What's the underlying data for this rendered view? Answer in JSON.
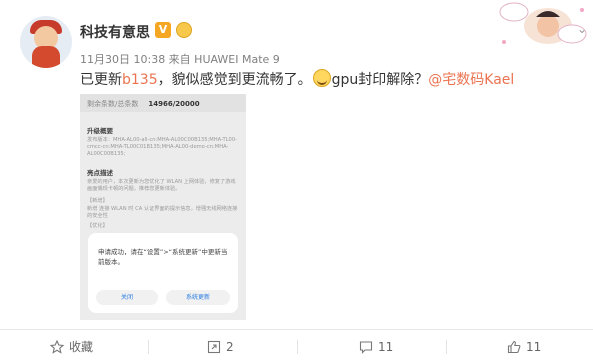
{
  "post": {
    "author": "科技有意思",
    "verified_badge": "V",
    "meta": "11月30日 10:38 来自 HUAWEI Mate 9",
    "text": {
      "part1": "已更新",
      "version": "b135",
      "part2": "，貌似感觉到更流畅了。",
      "part3": "gpu封印解除？",
      "mention": "@宅数码Kael"
    }
  },
  "screenshot": {
    "count_label": "剩余条数/总条数",
    "count_value": "14966/20000",
    "section1_title": "升级概要",
    "section1_body": "发布版本：MHA-AL00-all-cn:MHA-AL00C00B135;MHA-TL00-cmcc-cn:MHA-TL00C01B135;MHA-AL00-demo-cn:MHA-AL00C00B135;",
    "section2_title": "亮点描述",
    "section2_body": "亲爱的用户，本次更新为您优化了 WLAN 上网体验，修复了游戏画面偶现卡顿的问题，推荐您更新体验。",
    "section3_label": "【新增】",
    "section3_body": "新增 连接 WLAN 时 CA 认证界面的提示信息，增强无线网络连接的安全性",
    "section4_label": "【优化】",
    "dialog_message": "申请成功，请在“设置”>“系统更新”中更新当前版本。",
    "dialog_close": "关闭",
    "dialog_update": "系统更新"
  },
  "actions": {
    "favorite_label": "收藏",
    "repost_count": "2",
    "comment_count": "11",
    "like_count": "11"
  },
  "colors": {
    "accent": "#eb7350",
    "badge": "#f5a623",
    "link": "#2a7de1"
  }
}
